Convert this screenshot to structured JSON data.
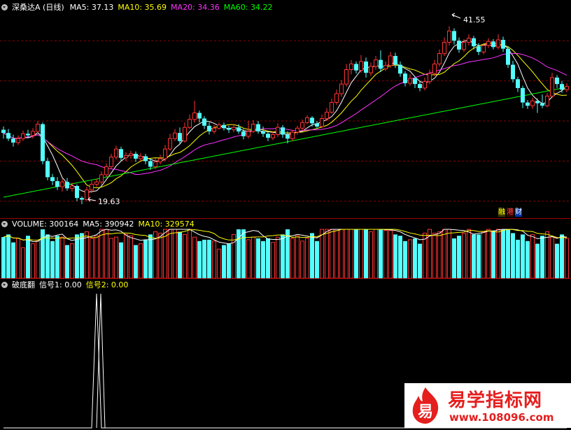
{
  "price_panel": {
    "title": "深桑达A (日线)",
    "ma_labels": [
      {
        "text": "MA5: 37.13",
        "color": "#ffffff"
      },
      {
        "text": "MA10: 35.69",
        "color": "#ffff00"
      },
      {
        "text": "MA20: 34.36",
        "color": "#ff33ff"
      },
      {
        "text": "MA60: 34.22",
        "color": "#00ff00"
      }
    ],
    "high_label": "41.55",
    "low_label": "19.63",
    "badges": [
      {
        "text": "融",
        "color": "#ffff00",
        "bg": "#3a3a00"
      },
      {
        "text": "港",
        "color": "#ff4444",
        "bg": "#3a0000"
      },
      {
        "text": "财",
        "color": "#ffffff",
        "bg": "#0033aa"
      }
    ]
  },
  "volume_panel": {
    "labels": [
      {
        "text": "VOLUME: 300164",
        "color": "#ffffff"
      },
      {
        "text": "MA5: 390942",
        "color": "#ffffff"
      },
      {
        "text": "MA10: 329574",
        "color": "#ffff00"
      }
    ]
  },
  "signal_panel": {
    "labels": [
      {
        "text": "破底翻",
        "color": "#ffffff"
      },
      {
        "text": "信号1: 0.00",
        "color": "#ffffff"
      },
      {
        "text": "信号2: 0.00",
        "color": "#ffff00"
      }
    ]
  },
  "watermark": {
    "logo_char": "易",
    "name": "易学指标网",
    "url": "www.108096.com"
  },
  "colors": {
    "up": "#ff3333",
    "down": "#54ffff",
    "ma5": "#ffffff",
    "ma10": "#ffff00",
    "ma20": "#ff33ff",
    "ma60": "#00ff00",
    "grid": "#8b0000",
    "divider": "#9a0000"
  },
  "chart_data": [
    {
      "type": "candlestick",
      "title": "深桑达A (日线)",
      "ylim": [
        18.5,
        43.5
      ],
      "grid": "dashed horizontal",
      "ohlc": [
        [
          28.9,
          28.5,
          29.3,
          27.8
        ],
        [
          28.5,
          27.8,
          29.0,
          27.5
        ],
        [
          27.8,
          27.3,
          28.3,
          26.8
        ],
        [
          27.3,
          27.8,
          28.2,
          27.0
        ],
        [
          27.8,
          28.4,
          28.8,
          27.5
        ],
        [
          28.4,
          28.2,
          28.9,
          27.9
        ],
        [
          28.2,
          28.7,
          29.1,
          27.8
        ],
        [
          28.7,
          29.6,
          30.0,
          28.5
        ],
        [
          29.6,
          25.0,
          29.8,
          24.6
        ],
        [
          25.0,
          23.0,
          25.4,
          22.6
        ],
        [
          23.0,
          22.5,
          23.4,
          22.0
        ],
        [
          22.5,
          21.8,
          23.0,
          21.4
        ],
        [
          21.8,
          22.4,
          22.8,
          21.2
        ],
        [
          22.4,
          21.6,
          22.9,
          21.3
        ],
        [
          21.6,
          21.9,
          22.3,
          21.2
        ],
        [
          21.9,
          20.4,
          22.1,
          20.0
        ],
        [
          20.4,
          20.2,
          20.6,
          19.63
        ],
        [
          20.2,
          21.4,
          21.8,
          20.0
        ],
        [
          21.4,
          22.1,
          22.6,
          21.0
        ],
        [
          22.1,
          22.4,
          22.8,
          21.8
        ],
        [
          22.4,
          23.3,
          23.7,
          22.0
        ],
        [
          23.3,
          24.3,
          24.7,
          23.0
        ],
        [
          24.3,
          25.5,
          25.9,
          24.0
        ],
        [
          25.5,
          26.5,
          26.9,
          25.2
        ],
        [
          26.5,
          25.4,
          26.8,
          25.0
        ],
        [
          25.4,
          25.7,
          26.1,
          25.0
        ],
        [
          25.7,
          25.9,
          26.3,
          25.3
        ],
        [
          25.9,
          25.3,
          26.2,
          24.9
        ],
        [
          25.3,
          25.6,
          26.0,
          25.0
        ],
        [
          25.6,
          25.0,
          25.9,
          24.6
        ],
        [
          25.0,
          24.3,
          25.3,
          23.9
        ],
        [
          24.3,
          24.9,
          25.3,
          24.0
        ],
        [
          24.9,
          25.3,
          25.8,
          24.6
        ],
        [
          25.3,
          26.5,
          27.0,
          25.0
        ],
        [
          26.5,
          27.8,
          28.4,
          26.3
        ],
        [
          27.8,
          28.5,
          29.0,
          27.5
        ],
        [
          28.5,
          27.5,
          29.2,
          27.2
        ],
        [
          27.5,
          29.2,
          29.8,
          27.3
        ],
        [
          29.2,
          30.2,
          30.8,
          29.0
        ],
        [
          30.2,
          31.0,
          32.5,
          29.8
        ],
        [
          31.0,
          30.3,
          31.3,
          29.8
        ],
        [
          30.3,
          29.4,
          30.6,
          29.0
        ],
        [
          29.4,
          28.7,
          29.8,
          28.3
        ],
        [
          28.7,
          29.1,
          29.5,
          28.4
        ],
        [
          29.1,
          29.5,
          29.8,
          28.9
        ],
        [
          29.5,
          29.1,
          29.8,
          28.8
        ],
        [
          29.1,
          28.9,
          29.4,
          28.5
        ],
        [
          28.9,
          29.2,
          29.6,
          28.6
        ],
        [
          29.2,
          28.7,
          29.6,
          28.4
        ],
        [
          28.7,
          28.1,
          29.0,
          27.7
        ],
        [
          28.1,
          28.7,
          30.0,
          27.8
        ],
        [
          28.7,
          29.6,
          30.1,
          28.5
        ],
        [
          29.6,
          28.7,
          30.0,
          28.4
        ],
        [
          28.7,
          28.4,
          29.3,
          28.0
        ],
        [
          28.4,
          27.9,
          28.6,
          27.5
        ],
        [
          27.9,
          28.3,
          28.7,
          27.6
        ],
        [
          28.3,
          29.2,
          29.7,
          28.0
        ],
        [
          29.2,
          28.3,
          29.5,
          27.9
        ],
        [
          28.3,
          27.8,
          28.7,
          27.2
        ],
        [
          27.8,
          28.6,
          28.9,
          27.5
        ],
        [
          28.6,
          29.1,
          29.4,
          28.3
        ],
        [
          29.1,
          29.8,
          30.2,
          28.8
        ],
        [
          29.8,
          30.4,
          30.7,
          29.6
        ],
        [
          30.4,
          29.7,
          30.6,
          29.3
        ],
        [
          29.7,
          29.3,
          30.0,
          29.0
        ],
        [
          29.3,
          30.3,
          30.8,
          29.1
        ],
        [
          30.3,
          31.1,
          31.6,
          30.0
        ],
        [
          31.1,
          32.3,
          32.8,
          30.9
        ],
        [
          32.3,
          33.4,
          33.9,
          32.0
        ],
        [
          33.4,
          34.6,
          35.1,
          33.0
        ],
        [
          34.6,
          36.4,
          37.1,
          34.3
        ],
        [
          36.4,
          37.1,
          37.6,
          35.8
        ],
        [
          37.1,
          36.3,
          37.4,
          35.9
        ],
        [
          36.3,
          37.4,
          38.2,
          36.0
        ],
        [
          37.4,
          36.0,
          37.9,
          35.4
        ],
        [
          36.0,
          36.8,
          37.3,
          35.6
        ],
        [
          36.8,
          37.6,
          38.1,
          36.4
        ],
        [
          37.6,
          36.5,
          38.8,
          36.1
        ],
        [
          36.5,
          36.9,
          37.4,
          36.2
        ],
        [
          36.9,
          38.1,
          38.6,
          36.6
        ],
        [
          38.1,
          37.0,
          38.5,
          36.6
        ],
        [
          37.0,
          35.9,
          37.4,
          35.5
        ],
        [
          35.9,
          34.7,
          36.2,
          34.3
        ],
        [
          34.7,
          35.3,
          35.8,
          34.4
        ],
        [
          35.3,
          34.6,
          35.6,
          34.1
        ],
        [
          34.6,
          34.1,
          35.0,
          33.7
        ],
        [
          34.1,
          34.9,
          35.4,
          33.8
        ],
        [
          34.9,
          35.9,
          36.4,
          34.6
        ],
        [
          35.9,
          37.1,
          37.6,
          35.6
        ],
        [
          37.1,
          38.4,
          38.9,
          36.8
        ],
        [
          38.4,
          39.8,
          40.4,
          38.1
        ],
        [
          39.8,
          41.2,
          41.8,
          39.4
        ],
        [
          41.2,
          40.0,
          41.55,
          39.5
        ],
        [
          40.0,
          38.9,
          40.4,
          38.5
        ],
        [
          38.9,
          39.8,
          40.2,
          38.6
        ],
        [
          39.8,
          40.3,
          40.8,
          39.4
        ],
        [
          40.3,
          39.3,
          40.6,
          38.9
        ],
        [
          39.3,
          38.6,
          39.7,
          38.2
        ],
        [
          38.6,
          39.4,
          39.7,
          38.3
        ],
        [
          39.4,
          39.9,
          40.3,
          39.1
        ],
        [
          39.9,
          39.2,
          40.2,
          38.9
        ],
        [
          39.2,
          40.1,
          40.8,
          38.9
        ],
        [
          40.1,
          39.0,
          40.5,
          38.6
        ],
        [
          39.0,
          37.0,
          39.3,
          36.6
        ],
        [
          37.0,
          35.2,
          37.5,
          34.8
        ],
        [
          35.2,
          34.1,
          35.5,
          33.6
        ],
        [
          34.1,
          32.3,
          34.4,
          31.6
        ],
        [
          32.3,
          31.9,
          32.6,
          31.5
        ],
        [
          31.9,
          32.5,
          32.9,
          31.5
        ],
        [
          32.5,
          32.2,
          32.8,
          31.0
        ],
        [
          32.2,
          31.9,
          33.3,
          31.6
        ],
        [
          31.9,
          33.1,
          33.5,
          31.7
        ],
        [
          33.1,
          35.4,
          36.0,
          32.8
        ],
        [
          35.4,
          34.6,
          35.7,
          34.1
        ],
        [
          34.6,
          33.9,
          35.0,
          33.5
        ],
        [
          33.9,
          34.3,
          34.7,
          33.6
        ]
      ],
      "ma_last": {
        "MA5": 37.13,
        "MA10": 35.69,
        "MA20": 34.36,
        "MA60": 34.22
      },
      "annotations": [
        {
          "text": "41.55",
          "type": "high"
        },
        {
          "text": "19.63",
          "type": "low"
        }
      ]
    },
    {
      "type": "bar",
      "title": "VOLUME",
      "ylim": [
        0,
        700000
      ],
      "values": [
        310000,
        330000,
        270000,
        300000,
        230000,
        320000,
        260000,
        280000,
        420000,
        330000,
        280000,
        320000,
        310000,
        250000,
        260000,
        330000,
        340000,
        350000,
        300000,
        320000,
        480000,
        410000,
        300000,
        310000,
        270000,
        330000,
        320000,
        250000,
        260000,
        290000,
        330000,
        350000,
        340000,
        410000,
        490000,
        380000,
        350000,
        330000,
        370000,
        310000,
        280000,
        290000,
        290000,
        280000,
        220000,
        250000,
        260000,
        330000,
        450000,
        420000,
        290000,
        310000,
        300000,
        280000,
        300000,
        270000,
        310000,
        330000,
        390000,
        300000,
        320000,
        280000,
        300000,
        340000,
        280000,
        430000,
        410000,
        450000,
        470000,
        400000,
        450000,
        420000,
        380000,
        400000,
        370000,
        350000,
        370000,
        380000,
        360000,
        360000,
        330000,
        320000,
        280000,
        290000,
        300000,
        260000,
        340000,
        400000,
        340000,
        350000,
        430000,
        410000,
        300000,
        320000,
        340000,
        370000,
        330000,
        330000,
        350000,
        400000,
        360000,
        380000,
        430000,
        380000,
        340000,
        290000,
        330000,
        280000,
        330000,
        260000,
        320000,
        350000,
        310000,
        260000,
        330000,
        300164
      ],
      "ma_last": {
        "MA5": 390942,
        "MA10": 329574
      }
    },
    {
      "type": "line",
      "title": "破底翻",
      "ylim": [
        0,
        1
      ],
      "series": [
        {
          "name": "信号1",
          "values": [
            0,
            0,
            0,
            0,
            0,
            0,
            0,
            0,
            0,
            0,
            0,
            0,
            0,
            0,
            0,
            0,
            0,
            0,
            0,
            1,
            0,
            0,
            0,
            0,
            0,
            0,
            0,
            0,
            0,
            0,
            0,
            0,
            0,
            0,
            0,
            0,
            0,
            0,
            0,
            0,
            0,
            0,
            0,
            0,
            0,
            0,
            0,
            0,
            0,
            0,
            0,
            0,
            0,
            0,
            0,
            0,
            0,
            0,
            0,
            0,
            0,
            0,
            0,
            0,
            0,
            0,
            0,
            0,
            0,
            0,
            0,
            0,
            0,
            0,
            0,
            0,
            0,
            0,
            0,
            0,
            0,
            0,
            0,
            0,
            0,
            0,
            0,
            0,
            0,
            0,
            0,
            0,
            0,
            0,
            0,
            0,
            0,
            0,
            0,
            0,
            0,
            0,
            0,
            0,
            0,
            0,
            0,
            0,
            0,
            0,
            0,
            0,
            0,
            0,
            0,
            0
          ]
        }
      ],
      "last_values": {
        "信号1": 0.0,
        "信号2": 0.0
      }
    }
  ]
}
